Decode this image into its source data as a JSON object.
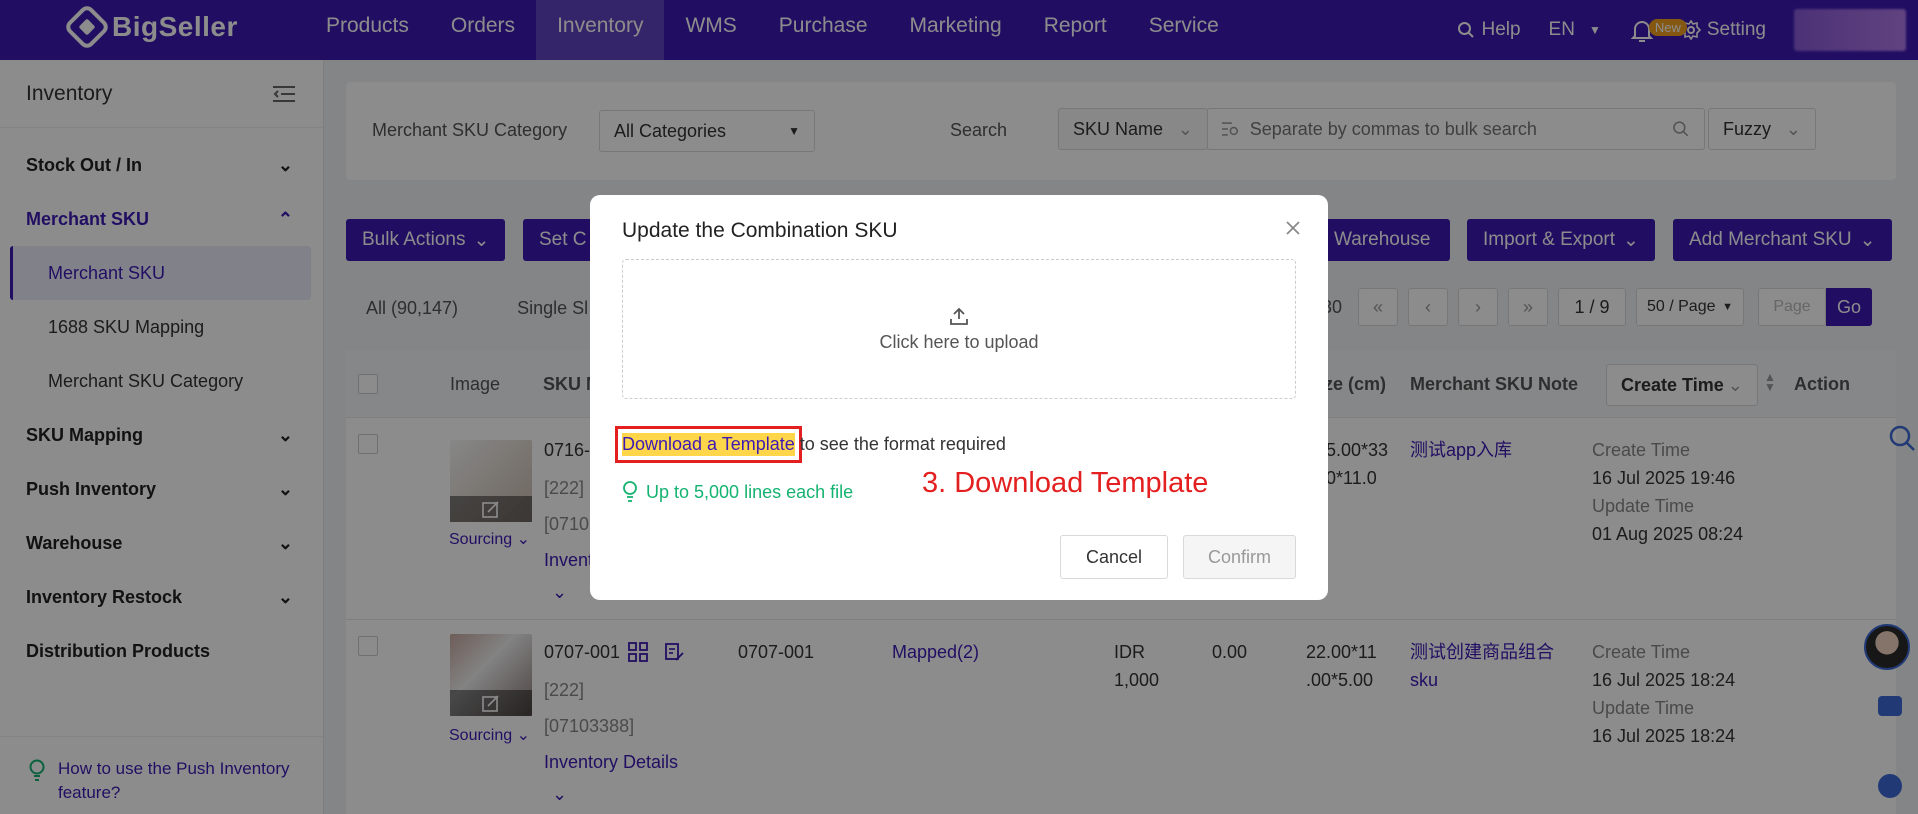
{
  "brand": {
    "name": "BigSeller"
  },
  "nav": {
    "items": [
      "Products",
      "Orders",
      "Inventory",
      "WMS",
      "Purchase",
      "Marketing",
      "Report",
      "Service"
    ],
    "help": "Help",
    "lang": "EN",
    "new_badge": "New",
    "setting": "Setting"
  },
  "sidebar": {
    "title": "Inventory",
    "groups": {
      "stock": "Stock Out / In",
      "merchant": "Merchant SKU",
      "mapping": "SKU Mapping",
      "push": "Push Inventory",
      "warehouse": "Warehouse",
      "restock": "Inventory Restock",
      "distribution": "Distribution Products"
    },
    "subs": [
      "Merchant SKU",
      "1688 SKU Mapping",
      "Merchant SKU Category"
    ],
    "help_text": "How to use the Push Inventory feature?"
  },
  "filters": {
    "category_label": "Merchant SKU Category",
    "category_value": "All Categories",
    "search_label": "Search",
    "search_field": "SKU Name",
    "search_placeholder": "Separate by commas to bulk search",
    "match_mode": "Fuzzy"
  },
  "toolbar": {
    "bulk": "Bulk Actions",
    "set": "Set C",
    "warehouse": "Warehouse",
    "import_export": "Import & Export",
    "add": "Add Merchant SKU"
  },
  "tabs": {
    "all": "All (90,147)",
    "single": "Single Sl"
  },
  "pager": {
    "count_fragment": "30",
    "page": "1 / 9",
    "per_page": "50 / Page",
    "page_placeholder": "Page",
    "go": "Go"
  },
  "table": {
    "headers": {
      "image": "Image",
      "sku": "SKU N",
      "size": "ze (cm)",
      "note": "Merchant SKU Note",
      "sort": "Create Time",
      "action": "Action"
    },
    "rows": [
      {
        "sku": "0716-",
        "code1": "[222]",
        "code2": "[0710",
        "inv": "Invent",
        "sourcing": "Sourcing",
        "size1": "5.00*33",
        "size2": "0*11.0",
        "note": "测试app入库",
        "create_label": "Create Time",
        "create": "16 Jul 2025 19:46",
        "update_label": "Update Time",
        "update": "01 Aug 2025 08:24"
      },
      {
        "sku": "0707-001",
        "code1": "[222]",
        "code2": "[07103388]",
        "inv": "Inventory Details",
        "sourcing": "Sourcing",
        "sku_code": "0707-001",
        "mapped": "Mapped(2)",
        "price1": "IDR",
        "price2": "1,000",
        "weight": "0.00",
        "size1": "22.00*11",
        "size2": ".00*5.00",
        "note1": "测试创建商品组合",
        "note2": "sku",
        "create_label": "Create Time",
        "create": "16 Jul 2025 18:24",
        "update_label": "Update Time",
        "update": "16 Jul 2025 18:24"
      }
    ]
  },
  "modal": {
    "title": "Update the Combination SKU",
    "upload": "Click here to upload",
    "download_link": "Download a Template",
    "download_suffix": " to see the format required",
    "tip": "Up to 5,000 lines each file",
    "annotation": "3. Download Template",
    "cancel": "Cancel",
    "confirm": "Confirm"
  },
  "colors": {
    "primary": "#3d1ab5",
    "annotation": "#e41f1f",
    "highlight": "#ffd54a",
    "tip": "#15b371"
  }
}
